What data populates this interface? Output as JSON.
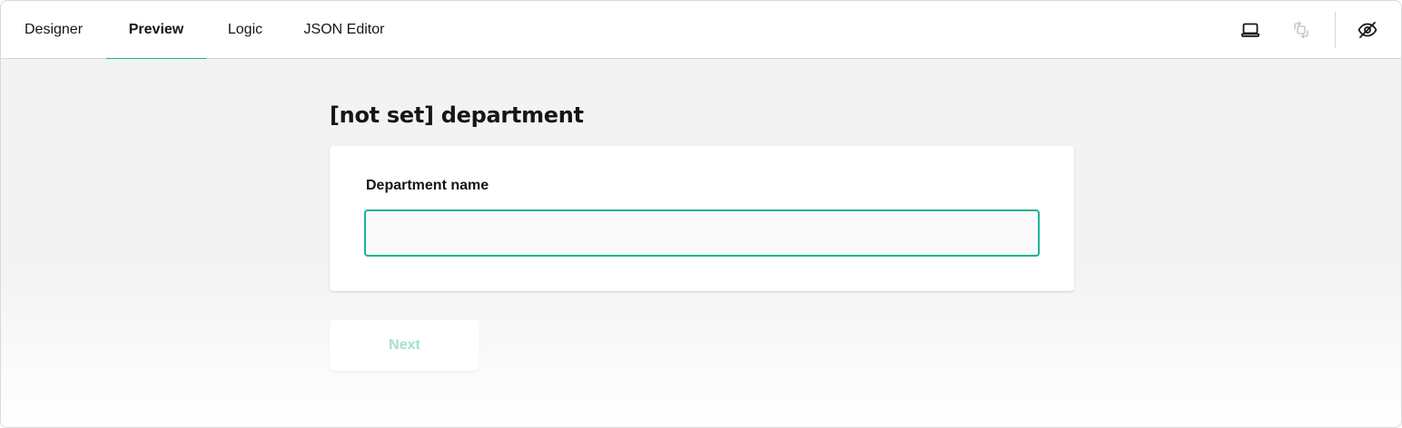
{
  "tabs": [
    {
      "label": "Designer",
      "active": false
    },
    {
      "label": "Preview",
      "active": true
    },
    {
      "label": "Logic",
      "active": false
    },
    {
      "label": "JSON Editor",
      "active": false
    }
  ],
  "toolbar": {
    "icons": [
      "laptop-icon",
      "orientation-icon",
      "eye-off-icon"
    ]
  },
  "survey": {
    "page_title": "[not set] department",
    "question_title": "Department name",
    "input_value": "",
    "next_label": "Next"
  },
  "colors": {
    "accent": "#19b394",
    "background": "#f3f3f3",
    "disabled_text": "#a5e0d3"
  }
}
